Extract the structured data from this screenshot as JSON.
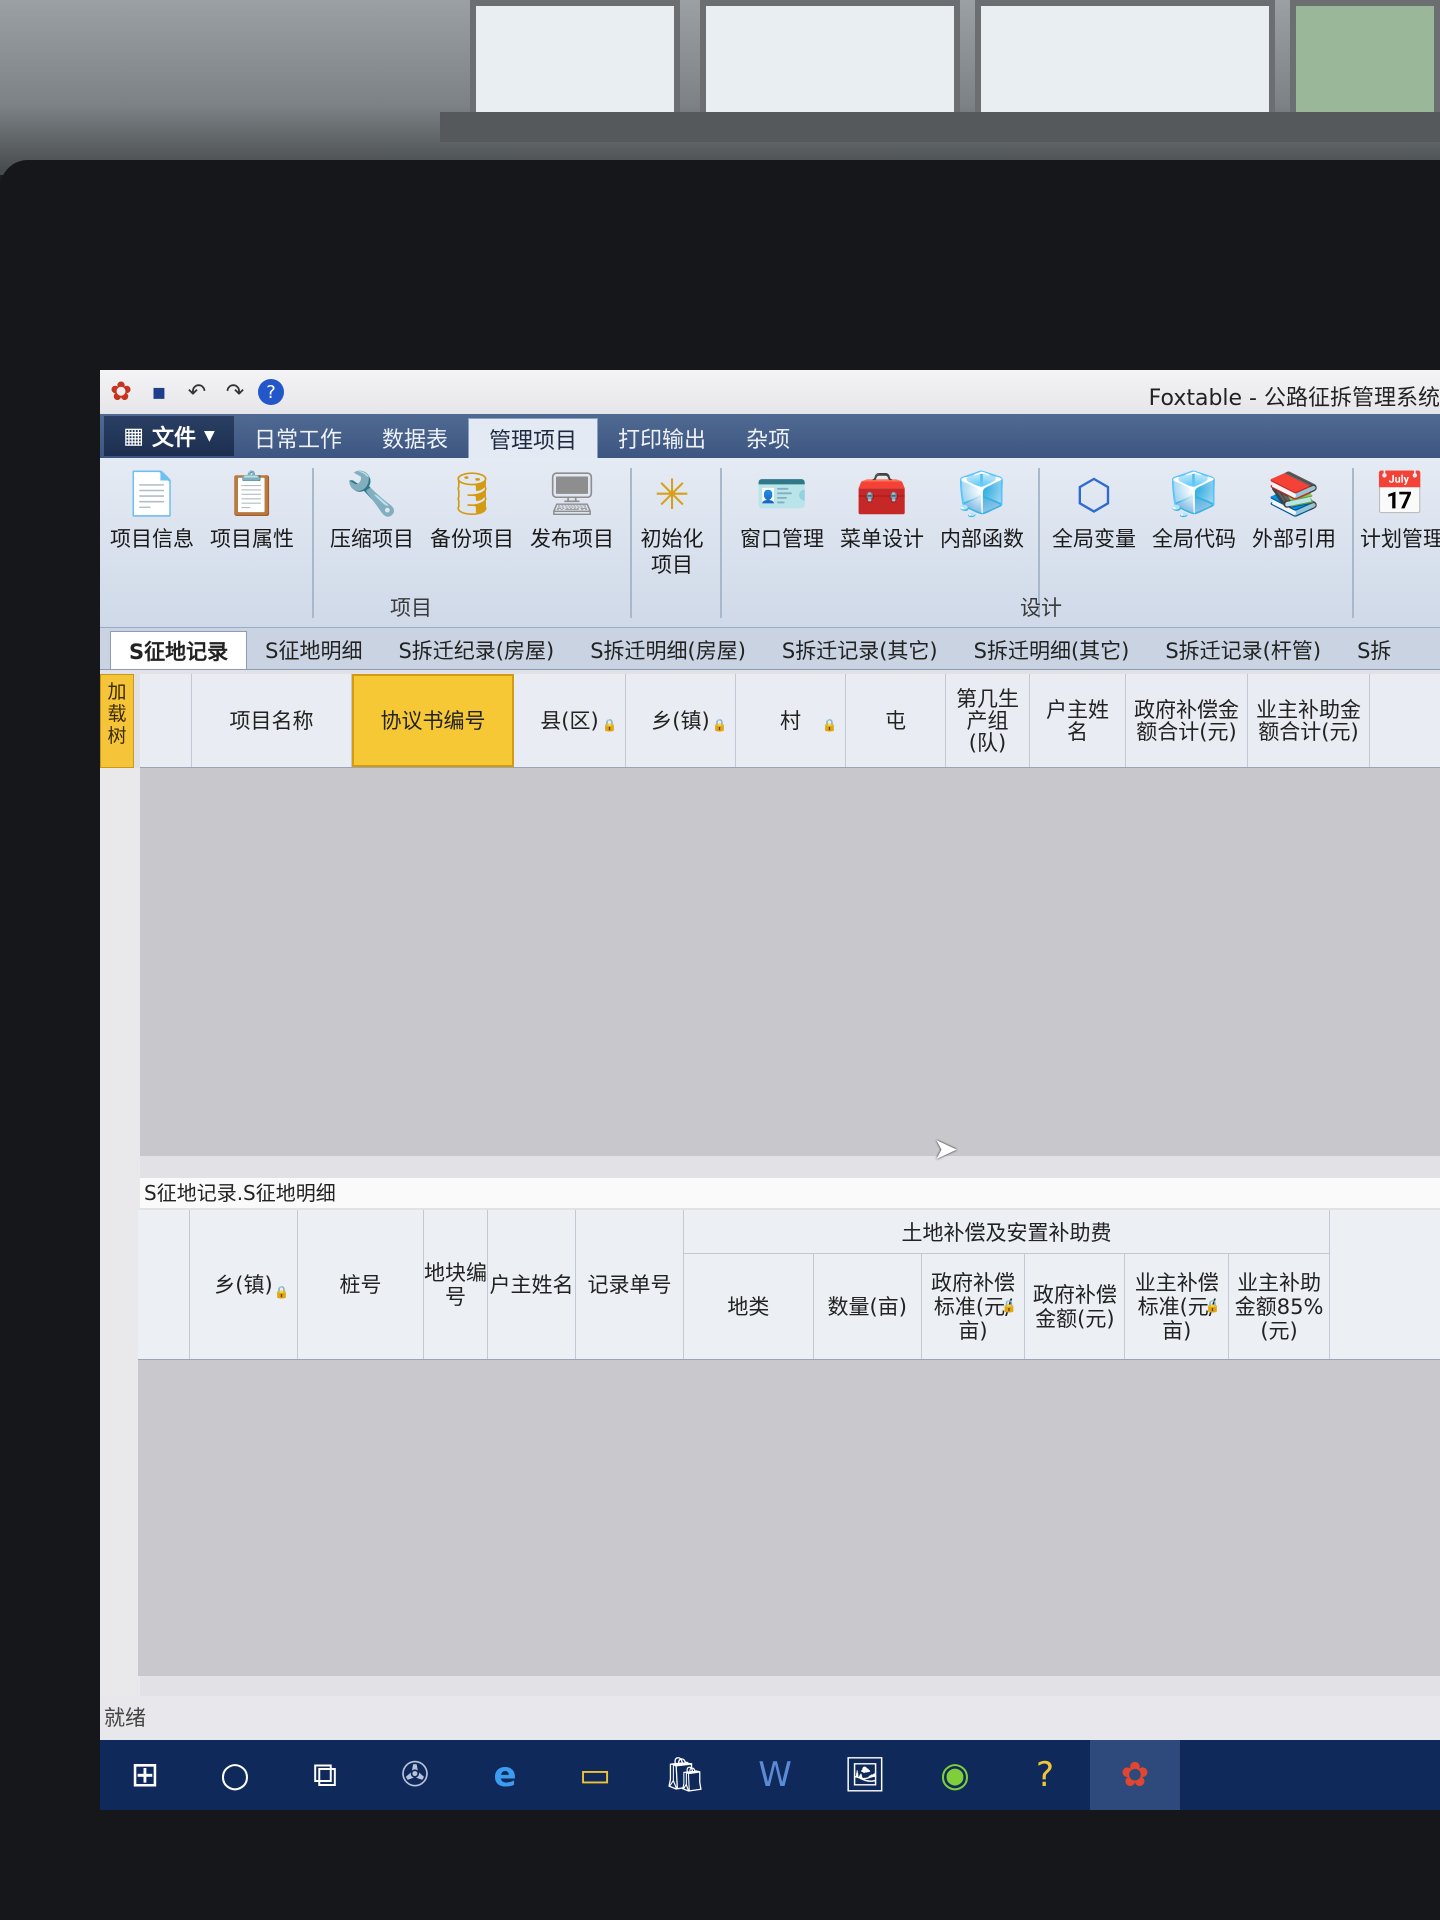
{
  "window": {
    "title": "Foxtable - 公路征拆管理系统"
  },
  "menu": {
    "file_label": "文件",
    "tabs": [
      "日常工作",
      "数据表",
      "管理项目",
      "打印输出",
      "杂项"
    ],
    "active_tab": "管理项目"
  },
  "ribbon": {
    "buttons": [
      "项目信息",
      "项目属性",
      "压缩项目",
      "备份项目",
      "发布项目",
      "初始化项目",
      "窗口管理",
      "菜单设计",
      "内部函数",
      "全局变量",
      "全局代码",
      "外部引用",
      "计划管理"
    ],
    "groups": [
      "项目",
      "设计"
    ]
  },
  "doc_tabs": [
    "S征地记录",
    "S征地明细",
    "S拆迁纪录(房屋)",
    "S拆迁明细(房屋)",
    "S拆迁记录(其它)",
    "S拆迁明细(其它)",
    "S拆迁记录(杆管)",
    "S拆"
  ],
  "side_tree_label": "加载树",
  "grid1": {
    "columns": [
      "项目名称",
      "协议书编号",
      "县(区)",
      "乡(镇)",
      "村",
      "屯",
      "第几生产组(队)",
      "户主姓名",
      "政府补偿金额合计(元)",
      "业主补助金额合计(元)"
    ],
    "selected_column": "协议书编号"
  },
  "grid2": {
    "caption": "S征地记录.S征地明细",
    "columns": [
      "乡(镇)",
      "桩号",
      "地块编号",
      "户主姓名",
      "记录单号"
    ],
    "group_title": "土地补偿及安置补助费",
    "group_columns": [
      "地类",
      "数量(亩)",
      "政府补偿标准(元/亩)",
      "政府补偿金额(元)",
      "业主补偿标准(元/亩)",
      "业主补助金额85%(元)"
    ]
  },
  "status": {
    "text": "就绪"
  },
  "taskbar_icons": [
    "windows-start-icon",
    "cortana-circle-icon",
    "task-view-icon",
    "fan-app-icon",
    "edge-browser-icon",
    "file-explorer-icon",
    "store-icon",
    "word-icon",
    "photo-app-icon",
    "green-browser-icon",
    "help-icon",
    "foxtable-app-icon"
  ]
}
